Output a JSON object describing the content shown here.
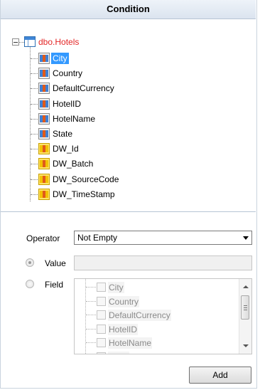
{
  "header": {
    "title": "Condition"
  },
  "tree": {
    "root": {
      "label": "dbo.Hotels"
    },
    "items": [
      {
        "label": "City",
        "kind": "column",
        "selected": true
      },
      {
        "label": "Country",
        "kind": "column"
      },
      {
        "label": "DefaultCurrency",
        "kind": "column"
      },
      {
        "label": "HotelID",
        "kind": "column"
      },
      {
        "label": "HotelName",
        "kind": "column"
      },
      {
        "label": "State",
        "kind": "column"
      },
      {
        "label": "DW_Id",
        "kind": "system-column"
      },
      {
        "label": "DW_Batch",
        "kind": "system-column"
      },
      {
        "label": "DW_SourceCode",
        "kind": "system-column"
      },
      {
        "label": "DW_TimeStamp",
        "kind": "system-column"
      }
    ]
  },
  "form": {
    "operator_label": "Operator",
    "operator_value": "Not Empty",
    "value_label": "Value",
    "value_text": "",
    "field_label": "Field",
    "field_items": [
      "City",
      "Country",
      "DefaultCurrency",
      "HotelID",
      "HotelName",
      "State"
    ],
    "add_label": "Add"
  },
  "colors": {
    "selection": "#3399ff",
    "root_text": "#e32626",
    "column_icon_blue": "#3f7fd3",
    "system_icon_yellow": "#ffe36a"
  }
}
